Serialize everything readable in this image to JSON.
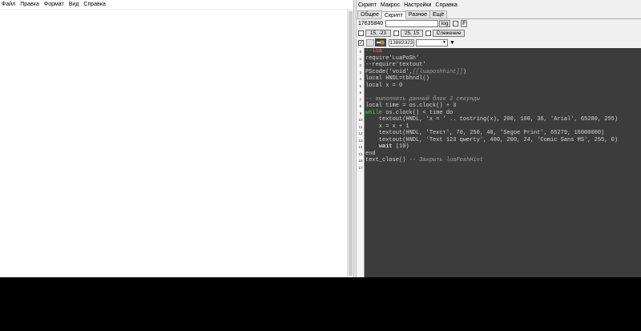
{
  "left_window": {
    "menu": [
      "Файл",
      "Правка",
      "Формат",
      "Вид",
      "Справка"
    ]
  },
  "right_window": {
    "menu": [
      "Скрипт",
      "Макрос",
      "Настройки",
      "Справка"
    ],
    "tabs": [
      "Общее",
      "Скрипт",
      "Разное",
      "Ещё"
    ],
    "active_tab": "Скрипт",
    "id_value": "17635840",
    "log_button": "log",
    "f_button": "F",
    "coord1": "15, -23",
    "coord2": "25, 15",
    "follow_button": "Слежение",
    "color_value": "13882323"
  },
  "editor": {
    "lines": [
      {
        "n": "0",
        "segments": [
          {
            "t": "--lua",
            "c": "kw"
          }
        ]
      },
      {
        "n": "1",
        "segments": [
          {
            "t": "require'LuaPoSh'",
            "c": ""
          }
        ]
      },
      {
        "n": "2",
        "segments": [
          {
            "t": "--require'textout'",
            "c": ""
          }
        ]
      },
      {
        "n": "3",
        "segments": [
          {
            "t": "PScode('void',",
            "c": ""
          },
          {
            "t": "[[luaposhhint]]",
            "c": "cm"
          },
          {
            "t": ")",
            "c": ""
          }
        ]
      },
      {
        "n": "4",
        "segments": [
          {
            "t": "local HNDL=tbhndl()",
            "c": ""
          }
        ]
      },
      {
        "n": "5",
        "segments": [
          {
            "t": "local x = 0",
            "c": ""
          }
        ]
      },
      {
        "n": "6",
        "segments": [
          {
            "t": "",
            "c": ""
          }
        ]
      },
      {
        "n": "7",
        "segments": [
          {
            "t": "-- выполнять данный блок 3 секунды",
            "c": "cm"
          }
        ]
      },
      {
        "n": "8",
        "segments": [
          {
            "t": "local time = os.clock() + 3",
            "c": ""
          }
        ]
      },
      {
        "n": "9",
        "segments": [
          {
            "t": "while",
            "c": "wh"
          },
          {
            "t": " os.clock() < time do",
            "c": ""
          }
        ]
      },
      {
        "n": "10",
        "segments": [
          {
            "t": "    textout(HNDL, 'x = ' .. tostring(x), 200, 100, 36, 'Arial', 65280, 255)",
            "c": ""
          }
        ]
      },
      {
        "n": "11",
        "segments": [
          {
            "t": "    x = x + 1",
            "c": ""
          }
        ]
      },
      {
        "n": "12",
        "segments": [
          {
            "t": "    textout(HNDL, 'Текст', 70, 250, 48, 'Segoe Print', 65279, 16000000)",
            "c": ""
          }
        ]
      },
      {
        "n": "13",
        "segments": [
          {
            "t": "    textout(HNDL, 'Text 123 qwerty', 400, 200, 24, 'Comic Sans MS', 255, 0)",
            "c": ""
          }
        ]
      },
      {
        "n": "14",
        "segments": [
          {
            "t": "    ",
            "c": ""
          },
          {
            "t": "wait",
            "c": "bold"
          },
          {
            "t": " (10)",
            "c": ""
          }
        ]
      },
      {
        "n": "15",
        "segments": [
          {
            "t": "end",
            "c": ""
          }
        ]
      },
      {
        "n": "16",
        "segments": [
          {
            "t": "text_close() ",
            "c": ""
          },
          {
            "t": "-- Закрыть luaPoshHint",
            "c": "cm"
          }
        ]
      },
      {
        "n": "17",
        "segments": [
          {
            "t": "",
            "c": ""
          }
        ]
      }
    ]
  }
}
